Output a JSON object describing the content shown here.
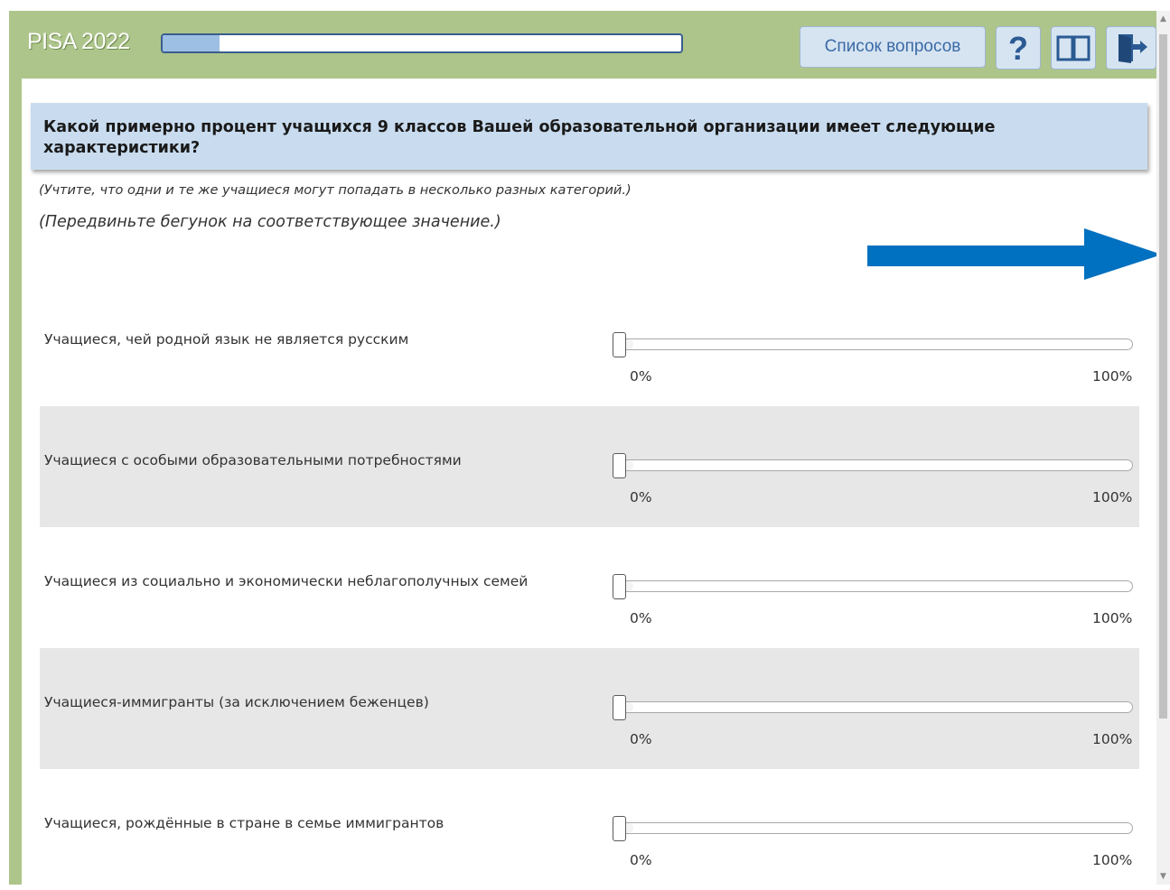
{
  "header": {
    "brand": "PISA 2022",
    "progress_percent": 11,
    "question_list_button": "Список вопросов"
  },
  "toolbar_icons": [
    "help-icon",
    "book-icon",
    "exit-icon"
  ],
  "question": {
    "title": "Какой примерно процент учащихся 9 классов Вашей образовательной организации имеет следующие характеристики?",
    "note1": "(Учтите, что одни и те же учащиеся могут попадать в несколько разных категорий.)",
    "note2": "(Передвиньте бегунок на соответствующее значение.)"
  },
  "colors": {
    "header_bg": "#adc58a",
    "question_bg": "#c9dcef",
    "arrow": "#0070c0",
    "row_shade": "#e7e7e7"
  },
  "sliders": [
    {
      "label": "Учащиеся, чей родной язык не является русским",
      "value": 0,
      "min_label": "0%",
      "max_label": "100%"
    },
    {
      "label": "Учащиеся с особыми образовательными потребностями",
      "value": 0,
      "min_label": "0%",
      "max_label": "100%"
    },
    {
      "label": "Учащиеся из социально и экономически неблагополучных семей",
      "value": 0,
      "min_label": "0%",
      "max_label": "100%"
    },
    {
      "label": "Учащиеся-иммигранты (за исключением беженцев)",
      "value": 0,
      "min_label": "0%",
      "max_label": "100%"
    },
    {
      "label": "Учащиеся, рождённые в стране в семье иммигрантов",
      "value": 0,
      "min_label": "0%",
      "max_label": "100%"
    }
  ]
}
